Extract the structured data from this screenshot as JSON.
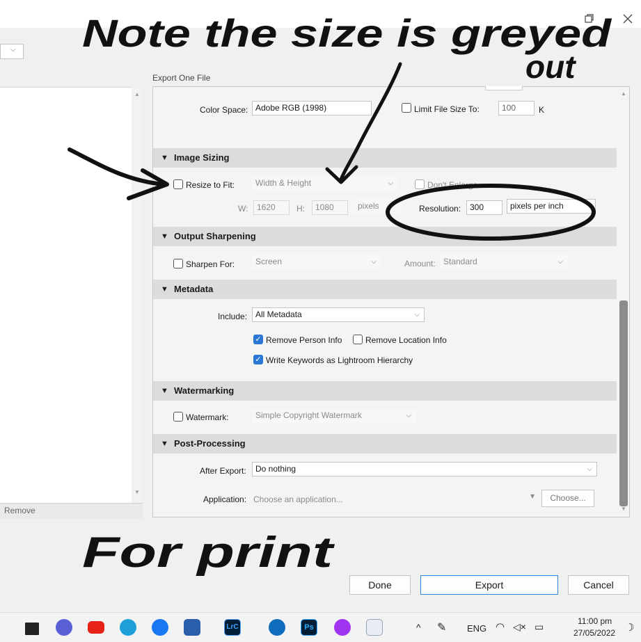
{
  "window": {
    "title": "Export One File",
    "controls": [
      "restore-icon",
      "close-icon"
    ]
  },
  "left_panel": {
    "dropdown_caret": "chevron-down-icon",
    "remove_label": "Remove"
  },
  "color_space": {
    "label": "Color Space:",
    "value": "Adobe RGB (1998)",
    "limit_label": "Limit File Size To:",
    "limit_value": "100",
    "limit_unit": "K"
  },
  "image_sizing": {
    "header": "Image Sizing",
    "resize_label": "Resize to Fit:",
    "resize_mode": "Width & Height",
    "dont_enlarge": "Don't Enlarge",
    "w_label": "W:",
    "w_value": "1620",
    "h_label": "H:",
    "h_value": "1080",
    "units": "pixels",
    "resolution_label": "Resolution:",
    "resolution_value": "300",
    "resolution_units": "pixels per inch"
  },
  "output_sharpening": {
    "header": "Output Sharpening",
    "sharpen_label": "Sharpen For:",
    "sharpen_value": "Screen",
    "amount_label": "Amount:",
    "amount_value": "Standard"
  },
  "metadata": {
    "header": "Metadata",
    "include_label": "Include:",
    "include_value": "All Metadata",
    "remove_person": "Remove Person Info",
    "remove_location": "Remove Location Info",
    "write_keywords": "Write Keywords as Lightroom Hierarchy"
  },
  "watermarking": {
    "header": "Watermarking",
    "watermark_label": "Watermark:",
    "watermark_value": "Simple Copyright Watermark"
  },
  "post_processing": {
    "header": "Post-Processing",
    "after_label": "After Export:",
    "after_value": "Do nothing",
    "app_label": "Application:",
    "app_placeholder": "Choose an application...",
    "choose_button": "Choose..."
  },
  "buttons": {
    "done": "Done",
    "export": "Export",
    "cancel": "Cancel"
  },
  "annotations": {
    "top_note_line1": "Note the size is greyed",
    "top_note_line2": "out",
    "bottom_note": "For print"
  },
  "taskbar": {
    "apps": [
      "start-icon",
      "chat-icon",
      "youtube-icon",
      "edge-icon",
      "facebook-icon",
      "store-icon",
      "lightroom-classic-icon",
      "cortana-icon",
      "photoshop-icon",
      "messenger-icon",
      "word-icon"
    ],
    "lrc_label": "LrC",
    "ps_label": "Ps",
    "language": "ENG",
    "time": "11:00 pm",
    "date": "27/05/2022"
  },
  "colors": {
    "accent": "#2a78d4",
    "section_header": "#dcdcdc",
    "panel_bg": "#f4f4f4"
  }
}
